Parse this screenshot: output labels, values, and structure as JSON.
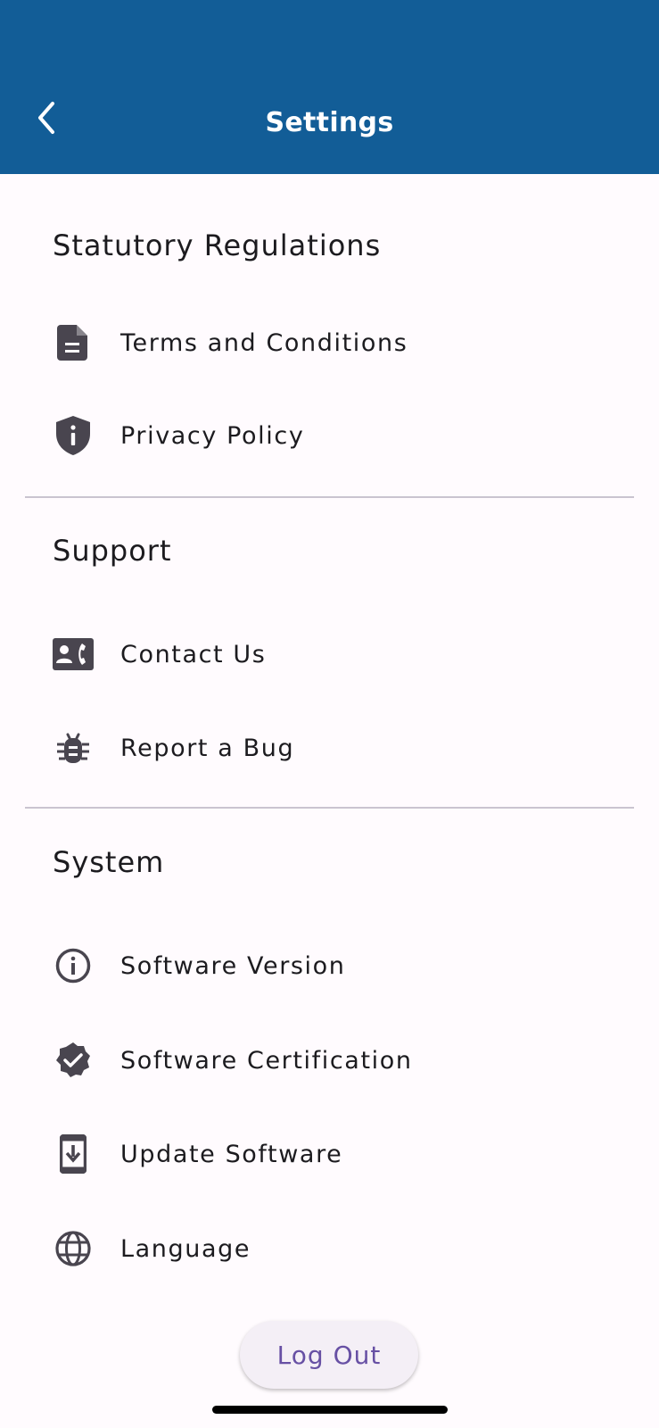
{
  "appbar": {
    "title": "Settings",
    "back_icon": "chevron-left-icon",
    "color": "#125d97"
  },
  "sections": {
    "statutory": {
      "title": "Statutory Regulations",
      "items": [
        {
          "label": "Terms and Conditions",
          "icon": "document-icon"
        },
        {
          "label": "Privacy Policy",
          "icon": "shield-info-icon"
        }
      ]
    },
    "support": {
      "title": "Support",
      "items": [
        {
          "label": "Contact Us",
          "icon": "contact-phone-icon"
        },
        {
          "label": "Report a Bug",
          "icon": "bug-icon"
        }
      ]
    },
    "system": {
      "title": "System",
      "items": [
        {
          "label": "Software Version",
          "icon": "info-icon"
        },
        {
          "label": "Software Certification",
          "icon": "verified-badge-icon"
        },
        {
          "label": "Update Software",
          "icon": "system-update-icon"
        },
        {
          "label": "Language",
          "icon": "globe-icon"
        }
      ]
    }
  },
  "logout": {
    "label": "Log Out",
    "text_color": "#6750a4"
  }
}
